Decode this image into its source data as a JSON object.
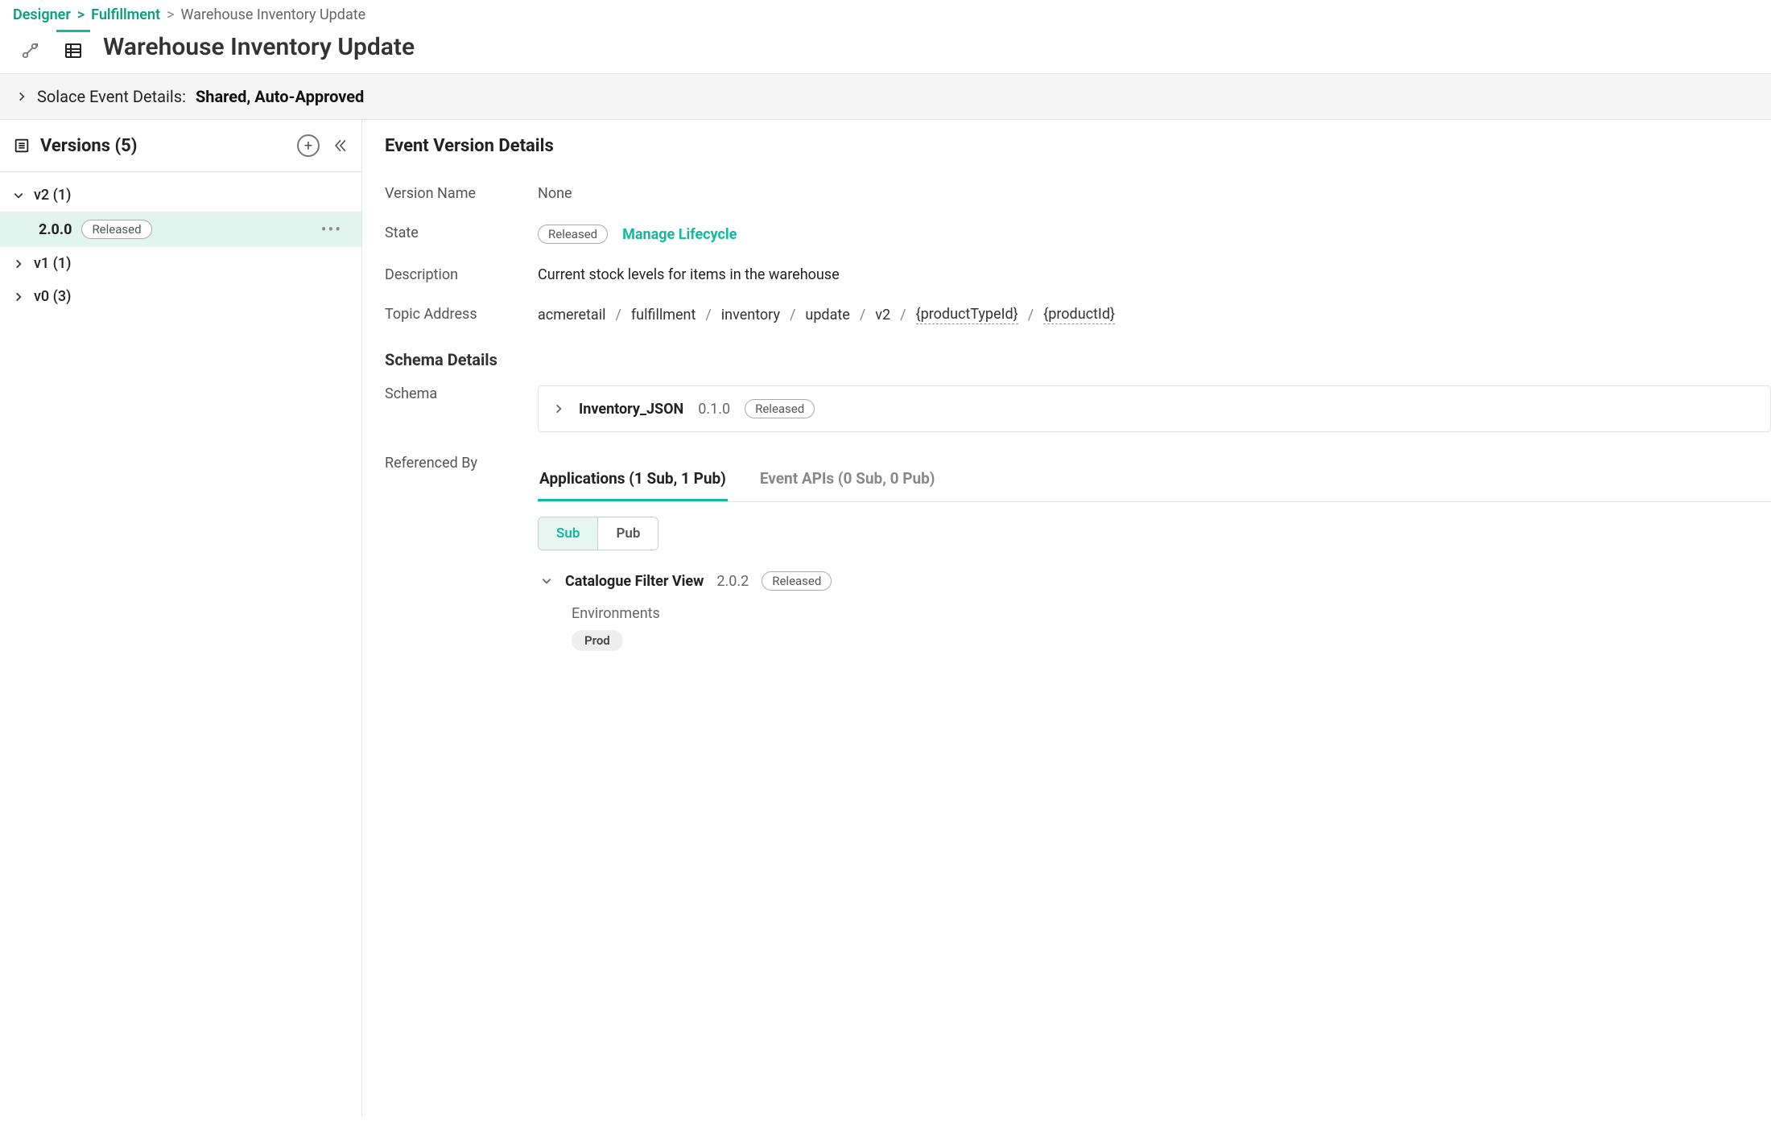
{
  "breadcrumb": {
    "designer": "Designer",
    "domain": "Fulfillment",
    "current": "Warehouse Inventory Update"
  },
  "page_title": "Warehouse Inventory Update",
  "banner": {
    "label": "Solace Event Details:",
    "value": "Shared, Auto-Approved"
  },
  "versions": {
    "title": "Versions (5)",
    "groups": [
      {
        "name": "v2 (1)",
        "expanded": true,
        "items": [
          {
            "version": "2.0.0",
            "state": "Released",
            "selected": true
          }
        ]
      },
      {
        "name": "v1 (1)",
        "expanded": false,
        "items": []
      },
      {
        "name": "v0 (3)",
        "expanded": false,
        "items": []
      }
    ]
  },
  "details": {
    "section_title": "Event Version Details",
    "labels": {
      "version_name": "Version Name",
      "state": "State",
      "description": "Description",
      "topic": "Topic Address",
      "schema_details": "Schema Details",
      "schema": "Schema",
      "referenced_by": "Referenced By"
    },
    "version_name": "None",
    "state_badge": "Released",
    "manage_lifecycle": "Manage Lifecycle",
    "description": "Current stock levels for items in the warehouse",
    "topic": {
      "parts": [
        "acmeretail",
        "fulfillment",
        "inventory",
        "update",
        "v2"
      ],
      "vars": [
        "{productTypeId}",
        "{productId}"
      ]
    },
    "schema": {
      "name": "Inventory_JSON",
      "version": "0.1.0",
      "state": "Released"
    },
    "tabs": {
      "applications": "Applications (1 Sub, 1 Pub)",
      "event_apis": "Event APIs (0 Sub, 0 Pub)",
      "active": "applications"
    },
    "seg": {
      "sub": "Sub",
      "pub": "Pub",
      "active": "sub"
    },
    "ref_app": {
      "name": "Catalogue Filter View",
      "version": "2.0.2",
      "state": "Released",
      "env_label": "Environments",
      "env": "Prod"
    }
  }
}
